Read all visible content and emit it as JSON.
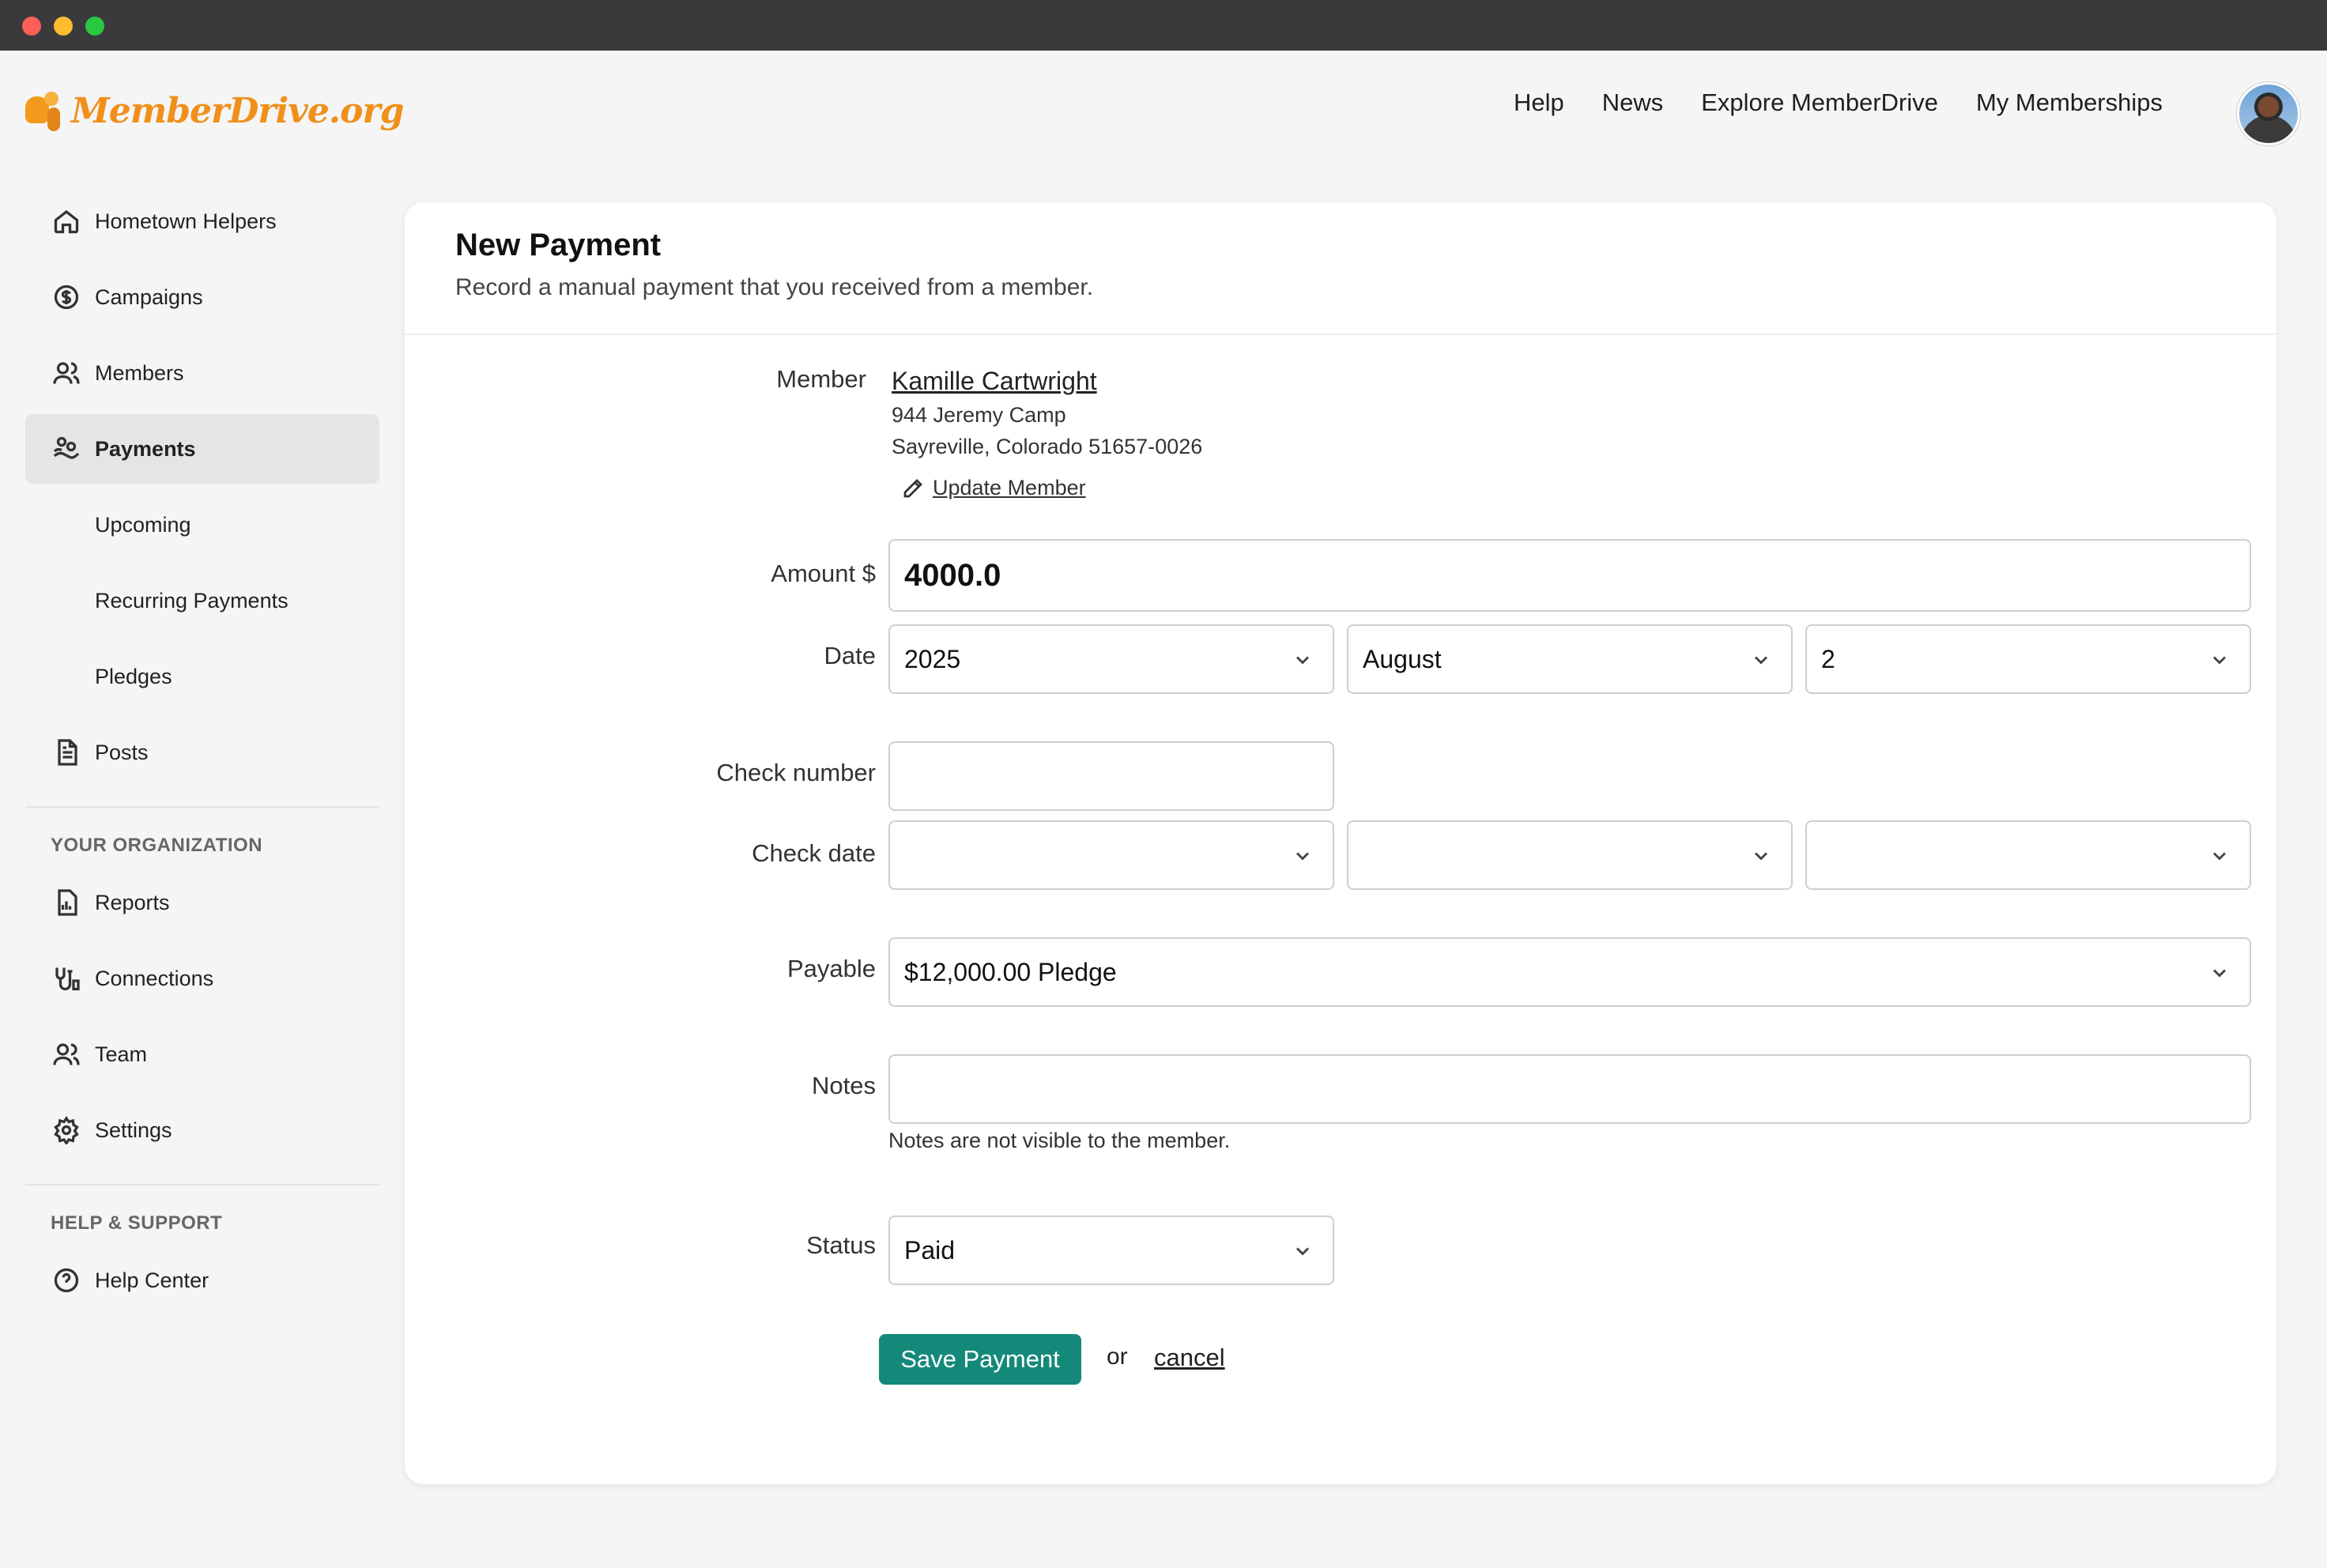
{
  "brand": {
    "name": "MemberDrive.org",
    "accent": "#f0901a"
  },
  "topnav": [
    {
      "label": "Help"
    },
    {
      "label": "News"
    },
    {
      "label": "Explore MemberDrive"
    },
    {
      "label": "My Memberships"
    }
  ],
  "sidebar": {
    "items": [
      {
        "label": "Hometown Helpers",
        "icon": "home-icon"
      },
      {
        "label": "Campaigns",
        "icon": "dollar-circle-icon"
      },
      {
        "label": "Members",
        "icon": "users-icon"
      },
      {
        "label": "Payments",
        "icon": "payments-icon",
        "active": true
      },
      {
        "label": "Upcoming"
      },
      {
        "label": "Recurring Payments"
      },
      {
        "label": "Pledges"
      },
      {
        "label": "Posts",
        "icon": "document-icon"
      }
    ],
    "org_heading": "YOUR ORGANIZATION",
    "org_items": [
      {
        "label": "Reports",
        "icon": "report-icon"
      },
      {
        "label": "Connections",
        "icon": "connections-icon"
      },
      {
        "label": "Team",
        "icon": "team-icon"
      },
      {
        "label": "Settings",
        "icon": "gear-icon"
      }
    ],
    "help_heading": "HELP & SUPPORT",
    "help_items": [
      {
        "label": "Help Center",
        "icon": "question-circle-icon"
      }
    ]
  },
  "page": {
    "title": "New Payment",
    "subtitle": "Record a manual payment that you received from a member."
  },
  "form": {
    "member_label": "Member",
    "member_name": "Kamille Cartwright",
    "member_address1": "944 Jeremy Camp",
    "member_address2": "Sayreville, Colorado 51657-0026",
    "update_member": "Update Member",
    "amount_label": "Amount $",
    "amount_value": "4000.0",
    "date_label": "Date",
    "date_year": "2025",
    "date_month": "August",
    "date_day": "2",
    "check_number_label": "Check number",
    "check_number_value": "",
    "check_date_label": "Check date",
    "check_date_year": "",
    "check_date_month": "",
    "check_date_day": "",
    "payable_label": "Payable",
    "payable_value": "$12,000.00 Pledge",
    "notes_label": "Notes",
    "notes_value": "",
    "notes_hint": "Notes are not visible to the member.",
    "status_label": "Status",
    "status_value": "Paid",
    "save_label": "Save Payment",
    "or_text": "or",
    "cancel_label": "cancel",
    "save_color": "#14897a"
  }
}
